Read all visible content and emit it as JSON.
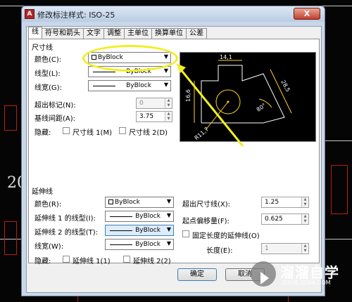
{
  "dialog": {
    "title": "修改标注样式: ISO-25",
    "close_label": "X"
  },
  "tabs": [
    {
      "label": "线"
    },
    {
      "label": "符号和箭头"
    },
    {
      "label": "文字"
    },
    {
      "label": "调整"
    },
    {
      "label": "主单位"
    },
    {
      "label": "换算单位"
    },
    {
      "label": "公差"
    }
  ],
  "dim_lines": {
    "group_title": "尺寸线",
    "color_label": "颜色(C):",
    "color_value": "ByBlock",
    "linetype_label": "线型(L):",
    "linetype_value": "ByBlock",
    "lineweight_label": "线宽(G):",
    "lineweight_value": "ByBlock",
    "extend_label": "超出标记(N):",
    "extend_value": "0",
    "baseline_label": "基线间距(A):",
    "baseline_value": "3.75",
    "suppress_label": "隐藏:",
    "suppress1_label": "尺寸线 1(M)",
    "suppress2_label": "尺寸线 2(D)"
  },
  "ext_lines": {
    "group_title": "延伸线",
    "color_label": "颜色(R):",
    "color_value": "ByBlock",
    "linetype1_label": "延伸线 1 的线型(I):",
    "linetype1_value": "ByBlock",
    "linetype2_label": "延伸线 2 的线型(T):",
    "linetype2_value": "ByBlock",
    "lineweight_label": "线宽(W):",
    "lineweight_value": "ByBlock",
    "suppress_label": "隐藏:",
    "suppress1_label": "延伸线 1(1)",
    "suppress2_label": "延伸线 2(2)",
    "beyond_label": "超出尺寸线(X):",
    "beyond_value": "1.25",
    "offset_label": "起点偏移量(F):",
    "offset_value": "0.625",
    "fixed_label": "固定长度的延伸线(O)",
    "length_label": "长度(E):",
    "length_value": "1"
  },
  "preview": {
    "dim_top": "14,1",
    "dim_left": "16,6",
    "dim_right": "28,5",
    "dim_angle": "80°",
    "dim_radius": "R11,7"
  },
  "buttons": {
    "ok": "确定",
    "cancel": "取消"
  },
  "background": {
    "cad_number": "20"
  },
  "watermark": {
    "title": "溜溜自学",
    "url": "ZIXUE.3D66.COM"
  },
  "colors": {
    "annotation": "#f2ee20",
    "preview_dim": "#ffd21f",
    "preview_line": "#ffffff",
    "cad_red": "#c01818"
  }
}
